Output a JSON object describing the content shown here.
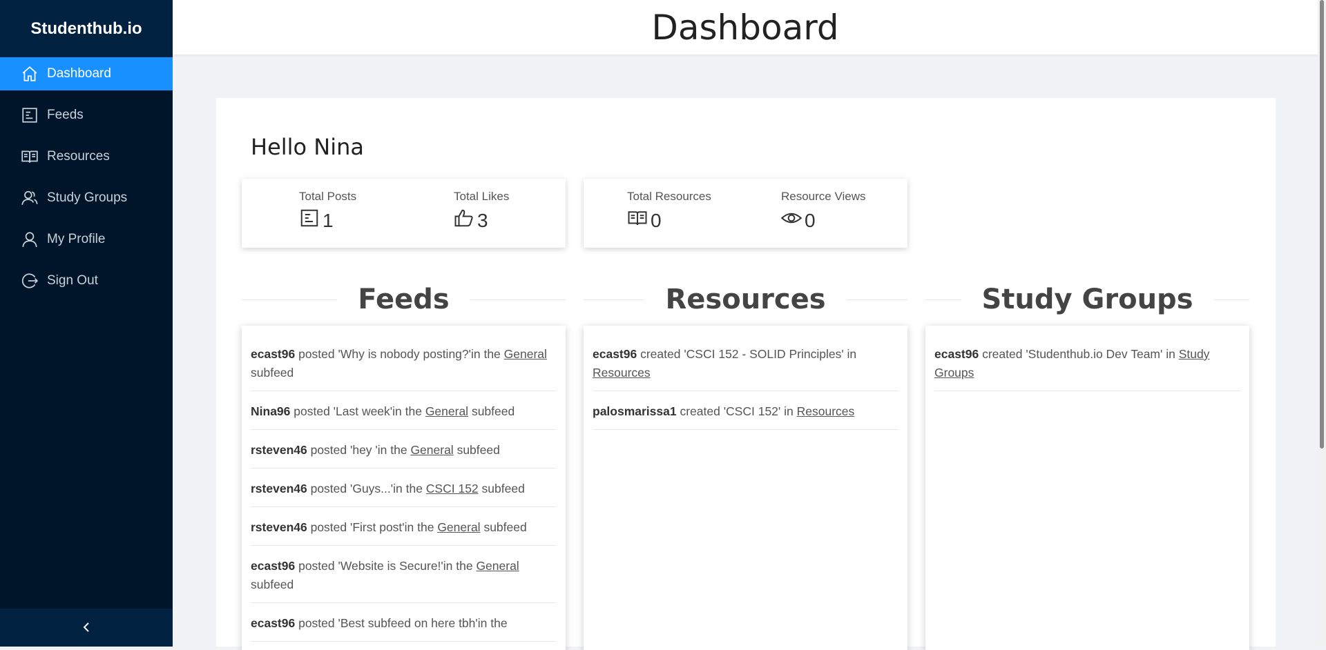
{
  "brand": "Studenthub.io",
  "sidebar": {
    "items": [
      {
        "label": "Dashboard",
        "icon": "home-icon"
      },
      {
        "label": "Feeds",
        "icon": "feed-icon"
      },
      {
        "label": "Resources",
        "icon": "book-icon"
      },
      {
        "label": "Study Groups",
        "icon": "group-icon"
      },
      {
        "label": "My Profile",
        "icon": "user-icon"
      },
      {
        "label": "Sign Out",
        "icon": "logout-icon"
      }
    ],
    "active_index": 0,
    "collapse_symbol": "<"
  },
  "header": {
    "title": "Dashboard"
  },
  "greeting": "Hello Nina",
  "stats": {
    "total_posts_label": "Total Posts",
    "total_posts": "1",
    "total_likes_label": "Total Likes",
    "total_likes": "3",
    "total_resources_label": "Total Resources",
    "total_resources": "0",
    "resource_views_label": "Resource Views",
    "resource_views": "0"
  },
  "sections": {
    "feeds": "Feeds",
    "resources": "Resources",
    "study_groups": "Study Groups"
  },
  "feeds": [
    {
      "user": "ecast96",
      "pre": " posted 'Why is nobody posting?'in the ",
      "link": "General",
      "post": " subfeed"
    },
    {
      "user": "Nina96",
      "pre": " posted 'Last week'in the ",
      "link": "General",
      "post": " subfeed"
    },
    {
      "user": "rsteven46",
      "pre": " posted 'hey 'in the ",
      "link": "General",
      "post": " subfeed"
    },
    {
      "user": "rsteven46",
      "pre": " posted 'Guys...'in the ",
      "link": "CSCI 152",
      "post": " subfeed"
    },
    {
      "user": "rsteven46",
      "pre": " posted 'First post'in the ",
      "link": "General",
      "post": " subfeed"
    },
    {
      "user": "ecast96",
      "pre": " posted 'Website is Secure!'in the ",
      "link": "General",
      "post": " subfeed"
    },
    {
      "user": "ecast96",
      "pre": " posted 'Best subfeed on here tbh'in the ",
      "link": "",
      "post": ""
    }
  ],
  "resources": [
    {
      "user": "ecast96",
      "pre": " created 'CSCI 152 - SOLID Principles' in ",
      "link": "Resources",
      "post": ""
    },
    {
      "user": "palosmarissa1",
      "pre": " created 'CSCI 152' in ",
      "link": "Resources",
      "post": ""
    }
  ],
  "study_groups": [
    {
      "user": "ecast96",
      "pre": " created 'Studenthub.io Dev Team' in ",
      "link": "Study Groups",
      "post": ""
    }
  ],
  "colors": {
    "sidebar_bg": "#001529",
    "active": "#1890ff",
    "page_bg": "#f0f2f5"
  }
}
